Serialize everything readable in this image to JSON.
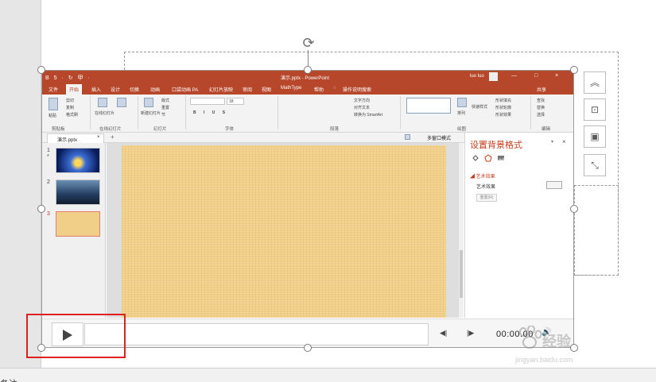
{
  "powerpoint": {
    "quick_access": "B 5 · ↻ 甲 ·",
    "window_title": "演示.pptx - PowerPoint",
    "user": "luo luo",
    "window_controls": "— □ ×",
    "tabs": [
      "文件",
      "开始",
      "插入",
      "设计",
      "切换",
      "动画",
      "口袋动画 PA",
      "幻灯片放映",
      "审阅",
      "视图",
      "MathType",
      "帮助",
      "操作说明搜索"
    ],
    "share": "共享",
    "ribbon": {
      "paste": "粘贴",
      "cut": "剪切",
      "copy": "复制",
      "format_painter": "格式刷",
      "online_slides": "在线幻灯片",
      "new_slide": "新建幻灯片",
      "reuse_slides": "重用幻灯片",
      "layout": "版式",
      "reset": "重置",
      "section": "节",
      "font_size": "18",
      "text_direction": "文字方向",
      "align_text": "对齐文本",
      "convert_smartart": "转换为 SmartArt",
      "arrange": "排列",
      "quick_styles": "快速样式",
      "shape_fill": "形状填充",
      "shape_outline": "形状轮廓",
      "shape_effects": "形状效果",
      "find": "查找",
      "replace": "替换",
      "select": "选择",
      "groups": [
        "剪贴板",
        "在线幻灯片",
        "幻灯片",
        "字体",
        "段落",
        "绘图",
        "编辑"
      ]
    },
    "doc_tab": "演示.pptx",
    "doc_tab_close": "×",
    "multi_window": "多窗口模式",
    "slides": [
      {
        "number": "1",
        "marker": "*"
      },
      {
        "number": "2"
      },
      {
        "number": "3"
      }
    ],
    "format_pane": {
      "title": "设置背景格式",
      "close": "×",
      "dropdown": "▾",
      "section": "◢ 艺术效果",
      "item": "艺术效果",
      "reset": "重置(R)"
    }
  },
  "player": {
    "prev": "◀|",
    "next": "|▶",
    "time": "00:00.00",
    "volume": "🔊"
  },
  "side_buttons": [
    "︽",
    "⊡",
    "▣",
    "⤡"
  ],
  "notes_label": "备注",
  "watermark": {
    "title": "经验",
    "url": "jingyan.baidu.com"
  }
}
